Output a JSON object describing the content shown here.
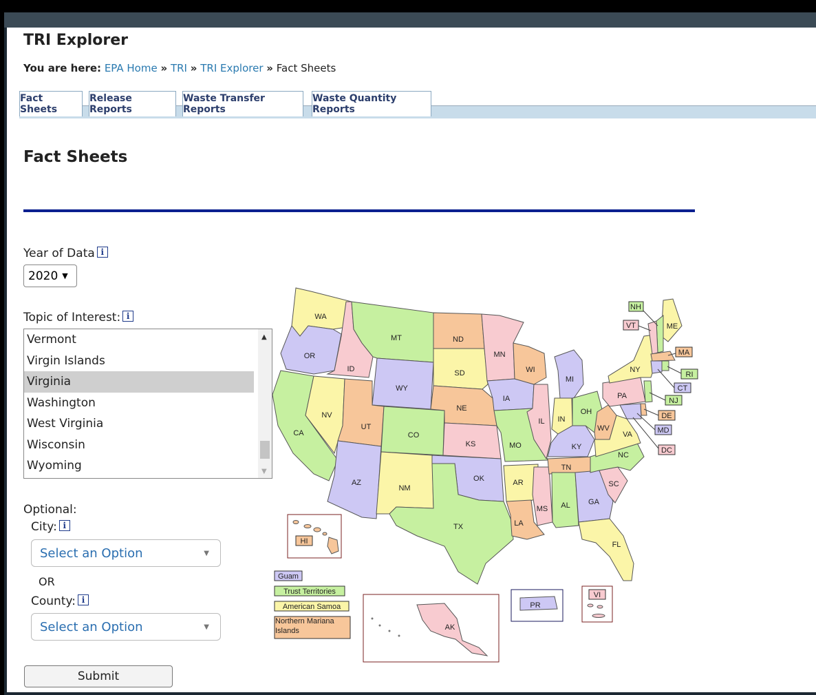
{
  "header": {
    "app_title": "TRI Explorer",
    "breadcrumb_prefix": "You are here:",
    "breadcrumb": [
      "EPA Home",
      "TRI",
      "TRI Explorer",
      "Fact Sheets"
    ],
    "breadcrumb_separator": "»"
  },
  "tabs": [
    "Fact Sheets",
    "Release Reports",
    "Waste Transfer Reports",
    "Waste Quantity Reports"
  ],
  "page_title": "Fact Sheets",
  "form": {
    "year_label": "Year of Data",
    "year_value": "2020",
    "topic_label": "Topic of Interest:",
    "topic_options": [
      "Vermont",
      "Virgin Islands",
      "Virginia",
      "Washington",
      "West Virginia",
      "Wisconsin",
      "Wyoming"
    ],
    "topic_selected": "Virginia",
    "optional_label": "Optional:",
    "city_label": "City:",
    "city_placeholder": "Select an Option",
    "or_label": "OR",
    "county_label": "County:",
    "county_placeholder": "Select an Option",
    "submit_label": "Submit",
    "info_icon_glyph": "i"
  },
  "map": {
    "states": [
      "WA",
      "OR",
      "CA",
      "ID",
      "NV",
      "MT",
      "WY",
      "UT",
      "AZ",
      "CO",
      "NM",
      "ND",
      "SD",
      "NE",
      "KS",
      "OK",
      "TX",
      "MN",
      "IA",
      "MO",
      "AR",
      "LA",
      "WI",
      "IL",
      "MS",
      "MI",
      "IN",
      "KY",
      "TN",
      "AL",
      "OH",
      "WV",
      "GA",
      "FL",
      "SC",
      "NC",
      "VA",
      "PA",
      "NY",
      "ME",
      "NH",
      "VT",
      "MA",
      "RI",
      "CT",
      "NJ",
      "DE",
      "MD",
      "DC",
      "HI",
      "AK",
      "PR",
      "VI"
    ],
    "territories": [
      "Guam",
      "Trust Territories",
      "American Samoa",
      "Northern Mariana Islands"
    ],
    "colors": {
      "green": "#c6f0a0",
      "yellow": "#fbf5a8",
      "purple": "#cdc8f4",
      "pink": "#f8cbd0",
      "orange": "#f7c69a"
    }
  }
}
